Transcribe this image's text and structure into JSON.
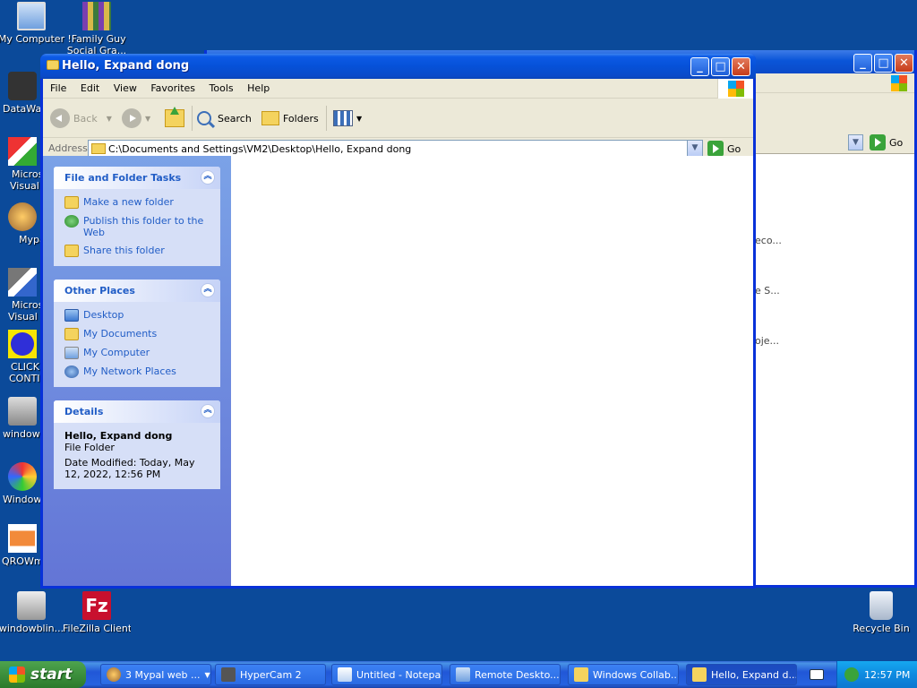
{
  "desktop": {
    "icons": [
      {
        "label": "My Computer",
        "icon": "my-computer-icon"
      },
      {
        "label": "!Family Guy",
        "label2": "Social Gra...",
        "icon": "winrar-icon"
      },
      {
        "label": "DataWa",
        "icon": "app-shortcut-icon"
      },
      {
        "label": "Micros",
        "label2": "Visual C",
        "icon": "visual-studio-icon"
      },
      {
        "label": "Mypa",
        "icon": "app-shortcut-icon"
      },
      {
        "label": "Micros",
        "label2": "Visual B",
        "icon": "visual-studio-icon"
      },
      {
        "label": "CLICK",
        "label2": "CONTIN",
        "icon": "click-icon"
      },
      {
        "label": "windowb",
        "icon": "app-shortcut-icon"
      },
      {
        "label": "Window",
        "icon": "paint-icon"
      },
      {
        "label": "QROWm'",
        "icon": "image-icon"
      },
      {
        "label": "windowblin...",
        "icon": "app-shortcut-icon"
      },
      {
        "label": "FileZilla Client",
        "icon": "filezilla-icon"
      },
      {
        "label": "Recycle Bin",
        "icon": "recycle-bin-icon"
      }
    ]
  },
  "background_window": {
    "go_label": "Go",
    "fragments": [
      "eco...",
      "e S...",
      "oje..."
    ]
  },
  "window": {
    "title": "Hello, Expand dong",
    "menu": [
      "File",
      "Edit",
      "View",
      "Favorites",
      "Tools",
      "Help"
    ],
    "toolbar": {
      "back": "Back",
      "search": "Search",
      "folders": "Folders"
    },
    "address": {
      "label": "Address",
      "value": "C:\\Documents and Settings\\VM2\\Desktop\\Hello, Expand dong",
      "go": "Go"
    },
    "tasks": {
      "file_folder": {
        "title": "File and Folder Tasks",
        "links": [
          "Make a new folder",
          "Publish this folder to the Web",
          "Share this folder"
        ]
      },
      "other_places": {
        "title": "Other Places",
        "links": [
          "Desktop",
          "My Documents",
          "My Computer",
          "My Network Places"
        ]
      },
      "details": {
        "title": "Details",
        "name": "Hello, Expand dong",
        "type": "File Folder",
        "modified": "Date Modified: Today, May 12, 2022, 12:56 PM"
      }
    }
  },
  "taskbar": {
    "start": "start",
    "items": [
      "3 Mypal web ...",
      "HyperCam 2",
      "Untitled - Notepad",
      "Remote Deskto...",
      "Windows Collab...",
      "Hello, Expand d..."
    ],
    "clock": "12:57 PM"
  },
  "colors": {
    "desktop": "#0b4a9a",
    "titlebar": "#0a55d8",
    "link": "#215dc6",
    "taskbar": "#2157d7",
    "start": "#3c8f3c"
  }
}
